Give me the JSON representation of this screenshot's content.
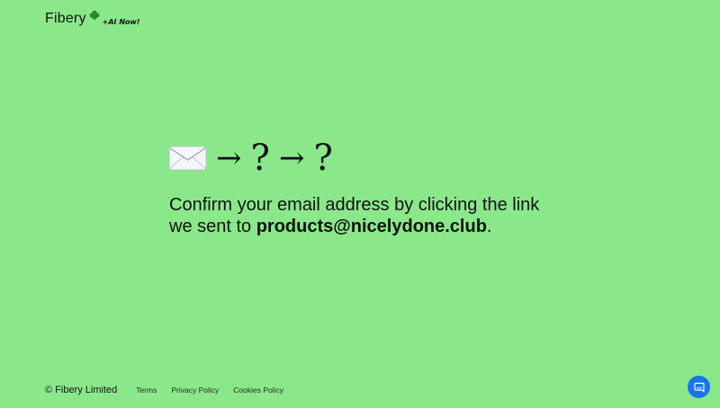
{
  "header": {
    "logo_text": "Fibery",
    "logo_icon": "clover-icon",
    "badge": "+AI Now!"
  },
  "flow": {
    "icon_start": "envelope-icon",
    "arrow": "→",
    "question": "?"
  },
  "message": {
    "text": "Confirm your email address by clicking the link we sent to ",
    "email": "products@nicelydone.club",
    "suffix": "."
  },
  "footer": {
    "copyright": "© Fibery Limited",
    "links": [
      "Terms",
      "Privacy Policy",
      "Cookies Policy"
    ]
  },
  "chat": {
    "icon": "chat-icon",
    "color": "#1874f0"
  },
  "colors": {
    "background": "#8ae88a",
    "clover": "#1f8a2a"
  }
}
